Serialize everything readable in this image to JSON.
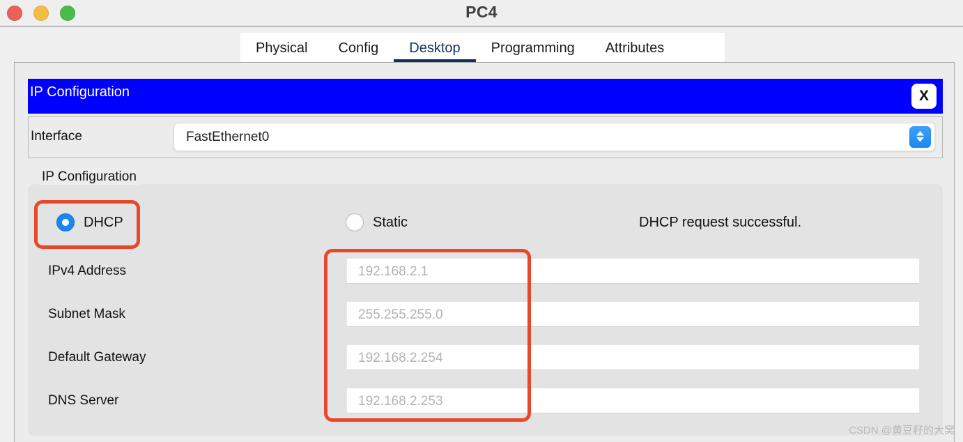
{
  "window": {
    "title": "PC4",
    "traffic_lights": [
      {
        "name": "close",
        "color": "#e8625a"
      },
      {
        "name": "minimize",
        "color": "#f2bc45"
      },
      {
        "name": "zoom",
        "color": "#4dbb4a"
      }
    ]
  },
  "tabs": [
    {
      "label": "Physical",
      "active": false
    },
    {
      "label": "Config",
      "active": false
    },
    {
      "label": "Desktop",
      "active": true
    },
    {
      "label": "Programming",
      "active": false
    },
    {
      "label": "Attributes",
      "active": false
    }
  ],
  "dialog": {
    "caption": "IP Configuration",
    "close_label": "X",
    "header_color": "#0000ff"
  },
  "interface": {
    "label": "Interface",
    "value": "FastEthernet0",
    "stepper_icon": "chevron-up-down-icon"
  },
  "ip_configuration": {
    "legend": "IP Configuration",
    "mode_options": [
      {
        "label": "DHCP",
        "selected": true
      },
      {
        "label": "Static",
        "selected": false
      }
    ],
    "dhcp_label": "DHCP",
    "static_label": "Static",
    "status_message": "DHCP request successful.",
    "fields": [
      {
        "label": "IPv4 Address",
        "value": "192.168.2.1"
      },
      {
        "label": "Subnet Mask",
        "value": "255.255.255.0"
      },
      {
        "label": "Default Gateway",
        "value": "192.168.2.254"
      },
      {
        "label": "DNS Server",
        "value": "192.168.2.253"
      }
    ]
  },
  "annotations": {
    "color": "#e8482a",
    "highlighted": [
      "dhcp-radio",
      "ip-field-values"
    ]
  },
  "watermark": "CSDN @黄豆籽的大窝"
}
